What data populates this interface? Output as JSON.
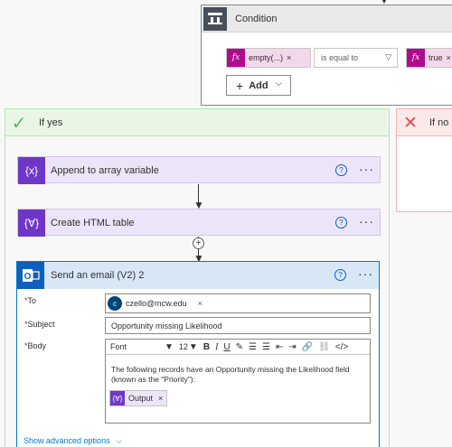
{
  "condition": {
    "title": "Condition",
    "left_token": {
      "fx": "fx",
      "label": "empty(...)",
      "remove": "×"
    },
    "operator": "is equal to",
    "right_token": {
      "fx": "fx",
      "label": "true",
      "remove": "×"
    },
    "add_label": "Add",
    "add_prefix": "+",
    "chevron": "⌵"
  },
  "if_yes": {
    "label": "If yes",
    "actions": [
      {
        "title": "Append to array variable",
        "icon": "{x}"
      },
      {
        "title": "Create HTML table",
        "icon": "{∀}"
      }
    ],
    "help": "?",
    "more": "···",
    "plus": "+"
  },
  "if_no": {
    "label": "If no"
  },
  "email": {
    "title": "Send an email (V2) 2",
    "to_label": "To",
    "to_avatar": "c",
    "to_value": "czello@mcw.edu",
    "to_remove": "×",
    "subject_label": "Subject",
    "subject_value": "Opportunity missing Likelihood",
    "body_label": "Body",
    "font_value": "Font",
    "font_size": "12",
    "body_text": "The following records have an Opportunity missing the Likelihood field (known as the \"Priority\"):",
    "output_label": "Output",
    "output_remove": "×",
    "show_advanced": "Show advanced options",
    "required_mark": "*"
  }
}
